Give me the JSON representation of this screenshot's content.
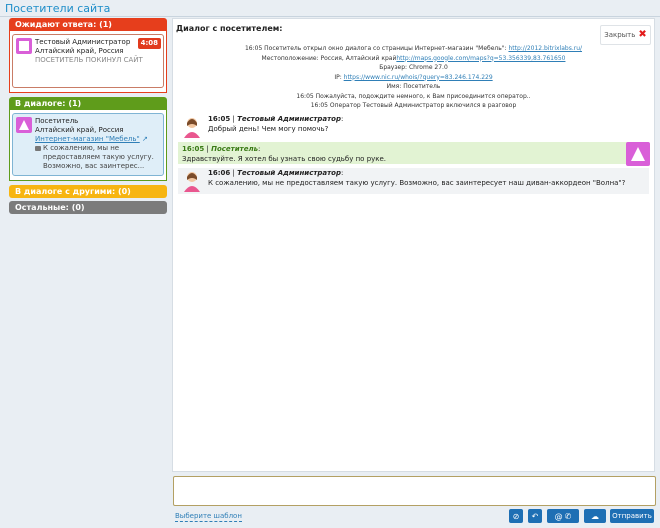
{
  "page_title": "Посетители сайта",
  "groups": {
    "waiting": {
      "label": "Ожидают ответа:",
      "count": "(1)",
      "card": {
        "operator": "Тестовый Администратор",
        "region": "Алтайский край, Россия",
        "status": "ПОСЕТИТЕЛЬ ПОКИНУЛ САЙТ",
        "timer": "4:08"
      }
    },
    "in_dialog": {
      "label": "В диалоге:",
      "count": "(1)",
      "card": {
        "visitor": "Посетитель",
        "region": "Алтайский край, Россия",
        "site": "Интернет-магазин \"Мебель\"",
        "snippet": "К сожалению, мы не предоставляем такую услугу. Возможно, вас заинтерес..."
      }
    },
    "others": {
      "label": "В диалоге с другими:",
      "count": "(0)"
    },
    "rest": {
      "label": "Остальные:",
      "count": "(0)"
    }
  },
  "dialog": {
    "title": "Диалог с посетителем:",
    "close_label": "Закрыть",
    "system": {
      "l1_text": "16:05  Посетитель открыл окно диалога со страницы Интернет-магазин \"Мебель\": ",
      "l1_link": "http://2012.bitrixlabs.ru/",
      "l2_text": "Местоположение: Россия, Алтайский край",
      "l2_link": "http://maps.google.com/maps?q=53.356339,83.761650",
      "l3": "Браузер: Chrome 27.0",
      "l4_text": "IP: ",
      "l4_link": "https://www.nic.ru/whois/?query=83.246.174.229",
      "l5": "Имя: Посетитель",
      "l6": "16:05  Пожалуйста, подождите немного, к Вам присоединится оператор..",
      "l7": "16:05  Оператор Тестовый Администратор включился в разговор"
    },
    "messages": [
      {
        "time": "16:05",
        "author": "Тестовый Администратор",
        "text": "Добрый день! Чем могу помочь?"
      },
      {
        "time": "16:05",
        "author": "Посетитель",
        "text": "Здравствуйте. Я хотел бы узнать свою судьбу по руке."
      },
      {
        "time": "16:06",
        "author": "Тестовый Администратор",
        "text": "К сожалению, мы не предоставляем такую услугу. Возможно, вас заинтересует наш диван-аккордеон \"Волна\"?"
      }
    ]
  },
  "composer": {
    "template_link": "Выберите шаблон",
    "send_label": "Отправить"
  },
  "colors": {
    "waiting": "#e63e1c",
    "in_dialog": "#5f9c1b",
    "others": "#f7b511",
    "rest": "#7b7b7b",
    "accent": "#1e6fb4"
  }
}
